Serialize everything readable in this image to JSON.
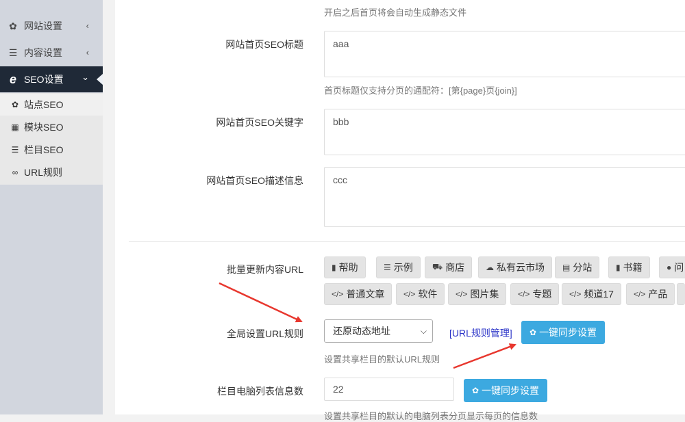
{
  "sidebar": {
    "items": [
      {
        "icon": "gear-icon",
        "glyph": "✿",
        "label": "网站设置",
        "chevron": "‹"
      },
      {
        "icon": "list-icon",
        "glyph": "☰",
        "label": "内容设置",
        "chevron": "‹"
      },
      {
        "icon": "ie-icon",
        "glyph": "e",
        "label": "SEO设置",
        "chevron": "⌄"
      }
    ],
    "subitems": [
      {
        "icon": "gear-icon",
        "glyph": "✿",
        "label": "站点SEO"
      },
      {
        "icon": "grid-icon",
        "glyph": "▦",
        "label": "模块SEO"
      },
      {
        "icon": "list-icon",
        "glyph": "☰",
        "label": "栏目SEO"
      },
      {
        "icon": "link-icon",
        "glyph": "∞",
        "label": "URL规则"
      }
    ]
  },
  "form": {
    "top_help": "开启之后首页将会自动生成静态文件",
    "seo_title": {
      "label": "网站首页SEO标题",
      "value": "aaa",
      "help": "首页标题仅支持分页的通配符：[第{page}页{join}]"
    },
    "seo_keywords": {
      "label": "网站首页SEO关键字",
      "value": "bbb"
    },
    "seo_description": {
      "label": "网站首页SEO描述信息",
      "value": "ccc"
    },
    "batch_update": {
      "label": "批量更新内容URL",
      "row1": [
        {
          "icon": "book-icon",
          "glyph": "▮",
          "label": "帮助"
        },
        {
          "icon": "list-icon",
          "glyph": "☰",
          "label": "示例"
        },
        {
          "icon": "cart-icon",
          "glyph": "⛟",
          "label": "商店"
        },
        {
          "icon": "cloud-icon",
          "glyph": "☁",
          "label": "私有云市场"
        },
        {
          "icon": "server-icon",
          "glyph": "▤",
          "label": "分站"
        },
        {
          "icon": "book-icon",
          "glyph": "▮",
          "label": "书籍"
        },
        {
          "icon": "comment-icon",
          "glyph": "●",
          "label": "问"
        }
      ],
      "row2": [
        {
          "icon": "code-icon",
          "glyph": "</>",
          "label": "普通文章"
        },
        {
          "icon": "code-icon",
          "glyph": "</>",
          "label": "软件"
        },
        {
          "icon": "code-icon",
          "glyph": "</>",
          "label": "图片集"
        },
        {
          "icon": "code-icon",
          "glyph": "</>",
          "label": "专题"
        },
        {
          "icon": "code-icon",
          "glyph": "</>",
          "label": "频道17"
        },
        {
          "icon": "code-icon",
          "glyph": "</>",
          "label": "产品"
        }
      ]
    },
    "global_url": {
      "label": "全局设置URL规则",
      "selected": "还原动态地址",
      "link": "[URL规则管理]",
      "sync_button": "一键同步设置",
      "help": "设置共享栏目的默认URL规则"
    },
    "pc_list": {
      "label": "栏目电脑列表信息数",
      "value": "22",
      "sync_button": "一键同步设置",
      "help": "设置共享栏目的默认的电脑列表分页显示每页的信息数"
    }
  },
  "colors": {
    "sidebar_bg": "#d2d6de",
    "active_bg": "#1f2937",
    "button_blue": "#3ca9e0",
    "arrow_red": "#e8372e",
    "link_blue": "#2b34c8"
  }
}
